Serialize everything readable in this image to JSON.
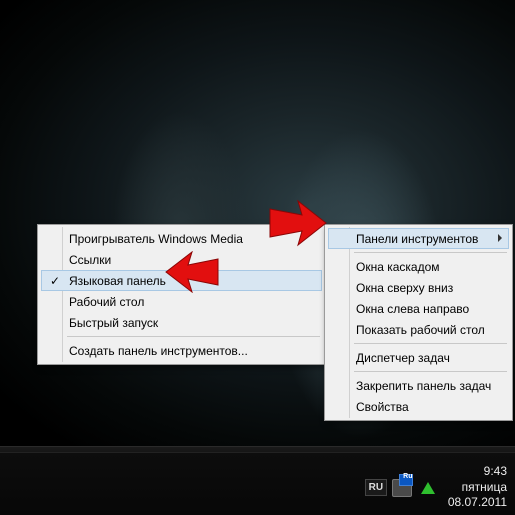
{
  "submenu": {
    "items": [
      {
        "label": "Проигрыватель Windows Media",
        "checked": false,
        "highlight": false
      },
      {
        "label": "Ссылки",
        "checked": false,
        "highlight": false
      },
      {
        "label": "Языковая панель",
        "checked": true,
        "highlight": true
      },
      {
        "label": "Рабочий стол",
        "checked": false,
        "highlight": false
      },
      {
        "label": "Быстрый запуск",
        "checked": false,
        "highlight": false
      }
    ],
    "footer": "Создать панель инструментов..."
  },
  "mainmenu": {
    "header": {
      "label": "Панели инструментов",
      "hasSubmenu": true,
      "highlight": true
    },
    "group2": [
      "Окна каскадом",
      "Окна сверху вниз",
      "Окна слева направо",
      "Показать рабочий стол"
    ],
    "group3": "Диспетчер задач",
    "group4": [
      "Закрепить панель задач",
      "Свойства"
    ]
  },
  "tray": {
    "lang": "RU",
    "kbd_badge": "Ru",
    "time": "9:43",
    "day": "пятница",
    "date": "08.07.2011"
  }
}
